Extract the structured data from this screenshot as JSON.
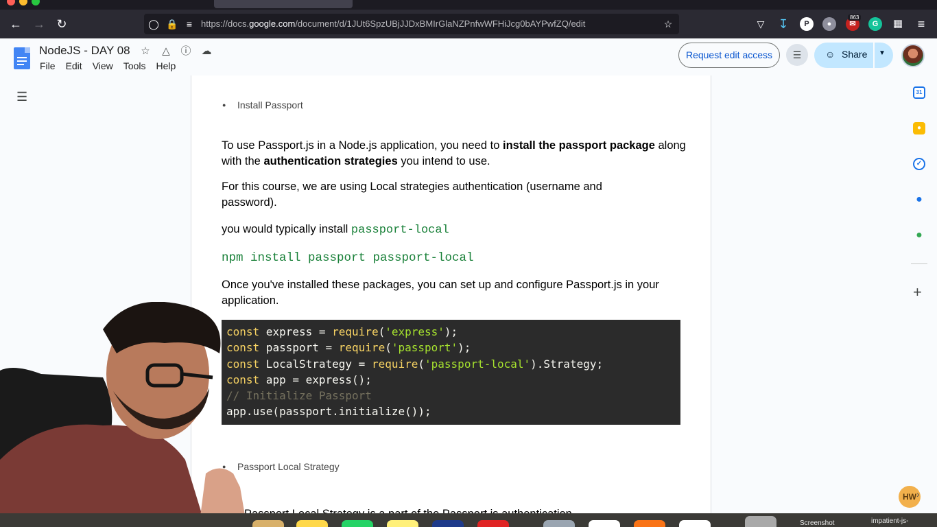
{
  "browser": {
    "url_prefix": "https://docs.",
    "url_domain": "google.com",
    "url_suffix": "/document/d/1JUt6SpzUBjJJDxBMIrGlaNZPnfwWFHiJcg0bAYPwfZQ/edit",
    "notification_count": "863",
    "ext_p": "P",
    "ext_g": "G"
  },
  "docs": {
    "title": "NodeJS - DAY 08",
    "menu": [
      "File",
      "Edit",
      "View",
      "Tools",
      "Help"
    ],
    "request_edit_label": "Request edit access",
    "share_label": "Share",
    "calendar_day": "31"
  },
  "document": {
    "bullet_install": "Install Passport",
    "p1_part1": "To use Passport.js in a Node.js application, you need to ",
    "p1_bold1": "install the passport package",
    "p1_part2": " along with the ",
    "p1_bold2": "authentication strategies",
    "p1_part3": " you intend to use.",
    "p2": "For this course, we are using Local strategies authentication (username and password).",
    "p3_text": "you would typically install ",
    "p3_code": "passport-local",
    "cmd": "npm install passport passport-local",
    "p4": "Once you've installed these packages, you can set up and configure Passport.js in your application.",
    "code": {
      "l1_kw": "const",
      "l1_a": " express = ",
      "l1_fn": "require",
      "l1_b": "(",
      "l1_str": "'express'",
      "l1_c": ");",
      "l2_kw": "const",
      "l2_a": " passport = ",
      "l2_fn": "require",
      "l2_b": "(",
      "l2_str": "'passport'",
      "l2_c": ");",
      "l3_kw": "const",
      "l3_a": " LocalStrategy = ",
      "l3_fn": "require",
      "l3_b": "(",
      "l3_str": "'passport-local'",
      "l3_c": ").Strategy;",
      "l4_kw": "const",
      "l4_a": " app = express();",
      "l5_comment": "// Initialize Passport",
      "l6": "app.use(passport.initialize());"
    },
    "bullet_strategy": "Passport Local Strategy",
    "cutoff_text": "The Passport Local Strategy is a part of the Passport.js authentication"
  },
  "dock": {
    "screenshot_label": "Screenshot",
    "impatient_label": "impatient-js-"
  },
  "overlay": {
    "hw_badge": "HW"
  },
  "colors": {
    "code_bg": "#2b2b2b",
    "code_keyword": "#f6d263",
    "code_string": "#a6e22e",
    "inline_code_green": "#188038",
    "share_bg": "#c2e7ff",
    "link_blue": "#0b57d0"
  }
}
